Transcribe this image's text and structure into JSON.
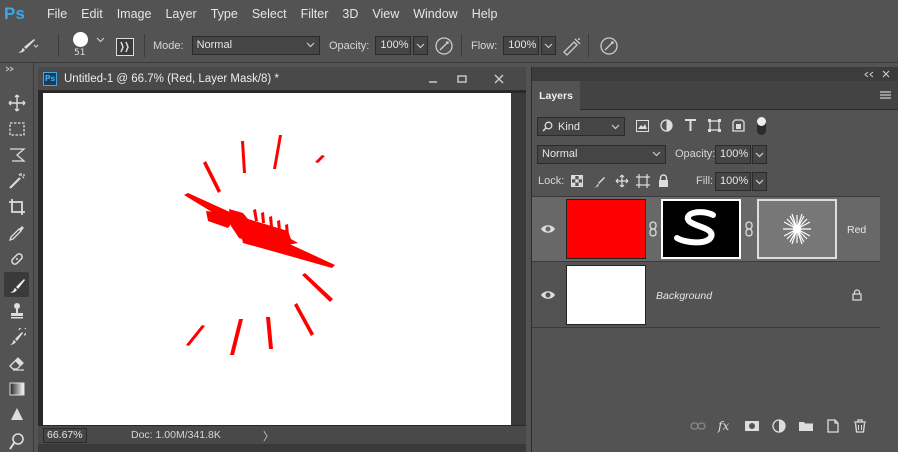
{
  "app": {
    "logo": "Ps"
  },
  "menu": [
    "File",
    "Edit",
    "Image",
    "Layer",
    "Type",
    "Select",
    "Filter",
    "3D",
    "View",
    "Window",
    "Help"
  ],
  "options": {
    "brush_size": "51",
    "mode_label": "Mode:",
    "mode_value": "Normal",
    "opacity_label": "Opacity:",
    "opacity_value": "100%",
    "flow_label": "Flow:",
    "flow_value": "100%"
  },
  "tools": [
    "move-icon",
    "marquee-icon",
    "lasso-icon",
    "magic-wand-icon",
    "crop-icon",
    "eyedropper-icon",
    "healing-icon",
    "brush-icon",
    "stamp-icon",
    "history-brush-icon",
    "eraser-icon",
    "gradient-icon",
    "blur-icon",
    "dodge-icon"
  ],
  "document": {
    "icon": "Ps",
    "title": "Untitled-1 @ 66.7% (Red, Layer Mask/8) *",
    "zoom": "66.67%",
    "doc_info": "Doc: 1.00M/341.8K",
    "status_arrow": "〉"
  },
  "layers_panel": {
    "tab": "Layers",
    "filter_label": "Kind",
    "blend_mode": "Normal",
    "opacity_label": "Opacity:",
    "opacity_value": "100%",
    "lock_label": "Lock:",
    "fill_label": "Fill:",
    "fill_value": "100%",
    "layers": [
      {
        "name": "Red",
        "selected": true,
        "color": "#ff0000"
      },
      {
        "name": "Background",
        "selected": false,
        "color": "#ffffff"
      }
    ]
  },
  "colors": {
    "accent": "#3fa6ea",
    "paint": "#ff0000",
    "bg": "#535353"
  }
}
